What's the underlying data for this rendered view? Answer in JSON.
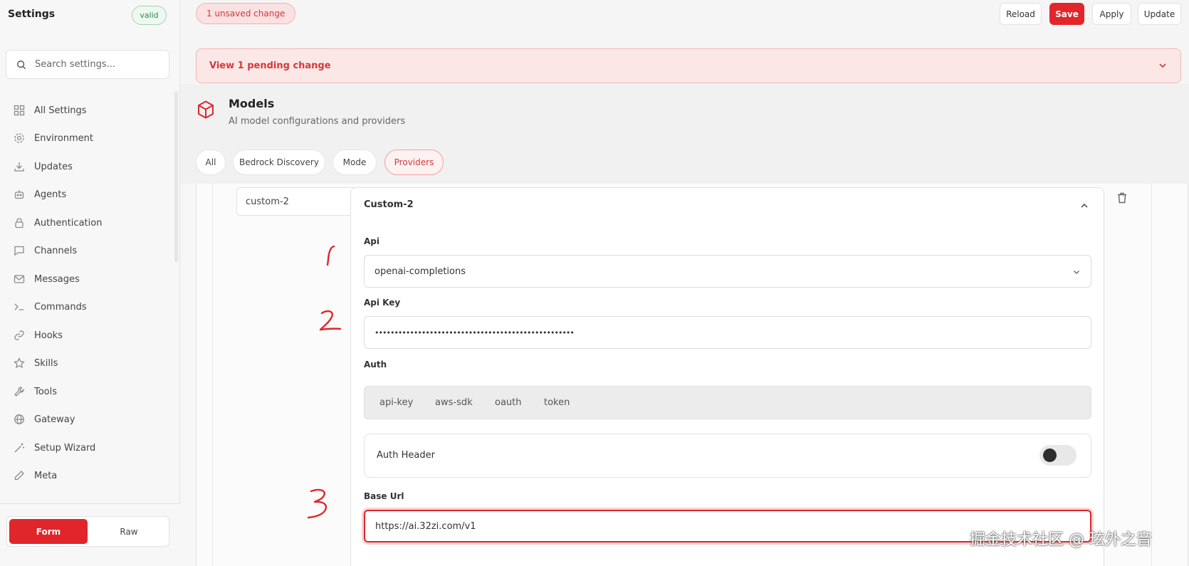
{
  "sidebar": {
    "title": "Settings",
    "badge": "valid",
    "search_placeholder": "Search settings...",
    "items": [
      {
        "label": "All Settings",
        "icon": "grid-icon"
      },
      {
        "label": "Environment",
        "icon": "gear-icon"
      },
      {
        "label": "Updates",
        "icon": "download-icon"
      },
      {
        "label": "Agents",
        "icon": "bot-icon"
      },
      {
        "label": "Authentication",
        "icon": "lock-icon"
      },
      {
        "label": "Channels",
        "icon": "chat-icon"
      },
      {
        "label": "Messages",
        "icon": "mail-icon"
      },
      {
        "label": "Commands",
        "icon": "terminal-icon"
      },
      {
        "label": "Hooks",
        "icon": "link-icon"
      },
      {
        "label": "Skills",
        "icon": "star-icon"
      },
      {
        "label": "Tools",
        "icon": "wrench-icon"
      },
      {
        "label": "Gateway",
        "icon": "globe-icon"
      },
      {
        "label": "Setup Wizard",
        "icon": "wand-icon"
      },
      {
        "label": "Meta",
        "icon": "pen-icon"
      }
    ],
    "mode": {
      "form": "Form",
      "raw": "Raw",
      "active": "form"
    }
  },
  "topbar": {
    "unsaved": "1 unsaved change",
    "reload": "Reload",
    "save": "Save",
    "apply": "Apply",
    "update": "Update"
  },
  "pending": "View 1 pending change",
  "section": {
    "title": "Models",
    "subtitle": "AI model configurations and providers",
    "icon": "cube-icon",
    "tabs": [
      "All",
      "Bedrock Discovery",
      "Mode",
      "Providers"
    ],
    "active_tab": "Providers"
  },
  "provider": {
    "key": "custom-2",
    "title": "Custom-2",
    "api_label": "Api",
    "api_value": "openai-completions",
    "api_key_label": "Api Key",
    "api_key_value": "•••••••••••••••••••••••••••••••••••••••••••••••••••",
    "auth_label": "Auth",
    "auth_options": [
      "api-key",
      "aws-sdk",
      "oauth",
      "token"
    ],
    "auth_header_label": "Auth Header",
    "auth_header_enabled": false,
    "base_url_label": "Base Url",
    "base_url_value": "https://ai.32zi.com/v1"
  },
  "watermark": "掘金技术社区 @ 玹外之音",
  "colors": {
    "accent": "#e0262b",
    "valid": "#2f8a4a",
    "annotation": "#e0262b"
  }
}
